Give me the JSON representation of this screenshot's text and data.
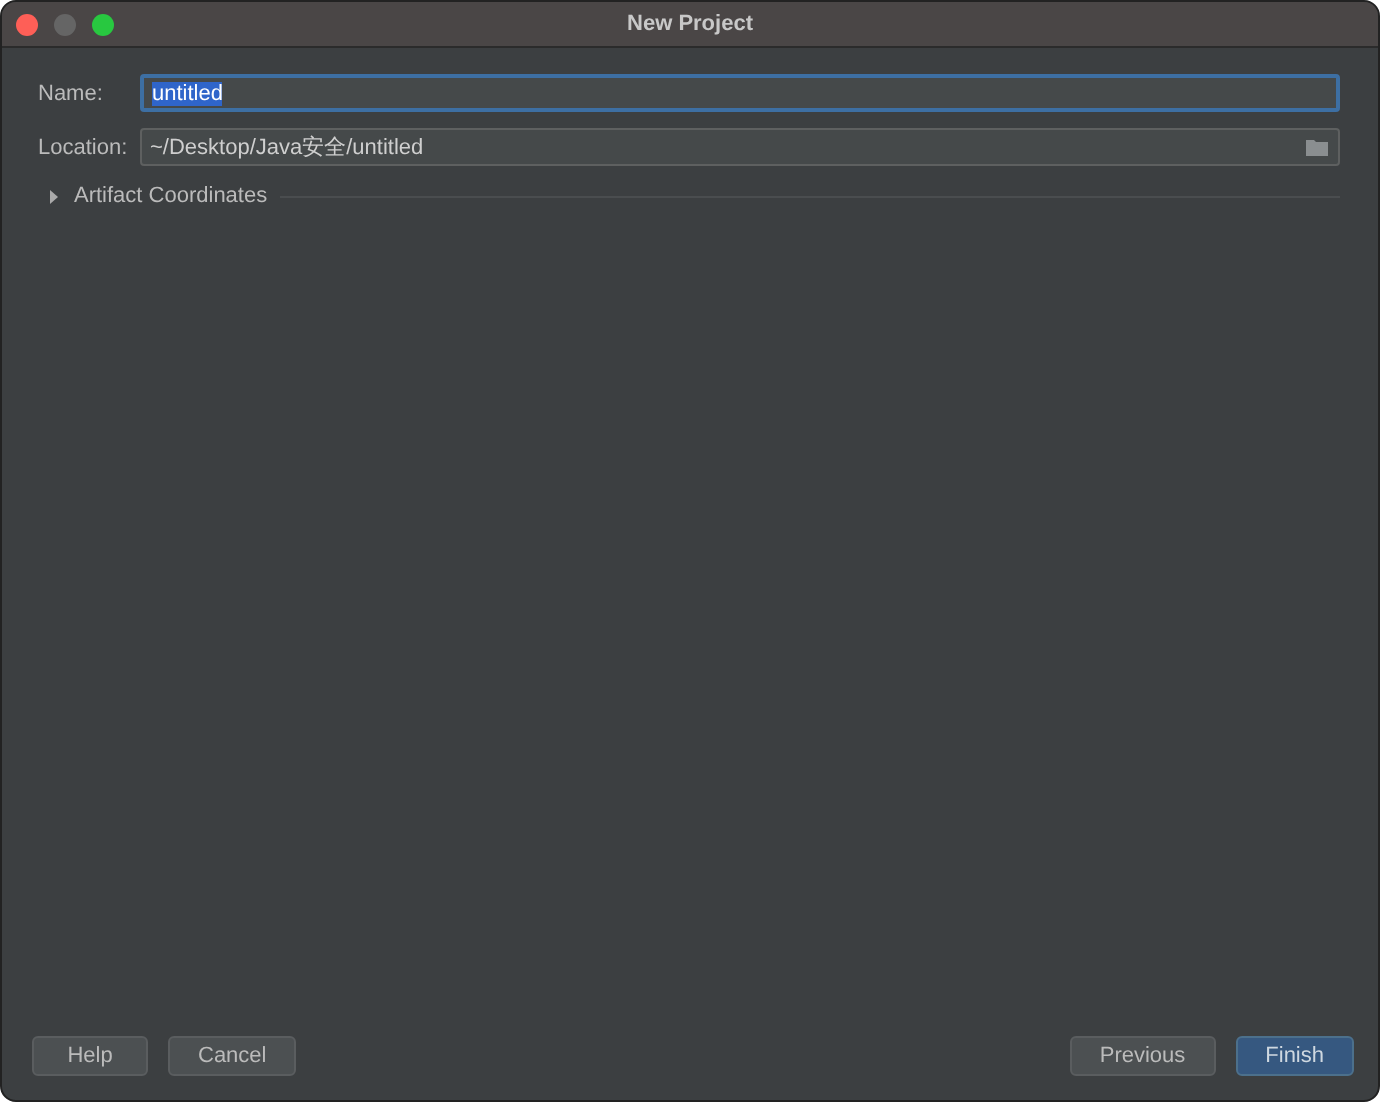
{
  "window": {
    "title": "New Project"
  },
  "fields": [
    {
      "label": "Name:",
      "value": "untitled",
      "focused": true,
      "kind": "text"
    },
    {
      "label": "Location:",
      "value": "~/Desktop/Java安全/untitled",
      "focused": false,
      "kind": "path"
    }
  ],
  "section": {
    "label": "Artifact Coordinates",
    "expanded": false
  },
  "left_buttons": [
    {
      "label": "Help",
      "kind": "normal"
    },
    {
      "label": "Cancel",
      "kind": "normal"
    }
  ],
  "right_buttons": [
    {
      "label": "Previous",
      "kind": "normal"
    },
    {
      "label": "Finish",
      "kind": "default"
    }
  ]
}
